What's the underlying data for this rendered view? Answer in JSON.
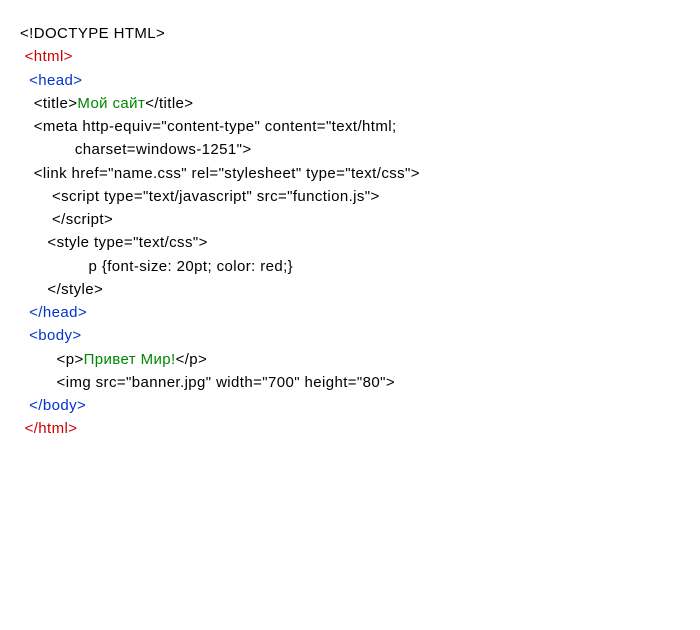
{
  "lines": [
    {
      "indent": 0,
      "segments": [
        {
          "cls": "black",
          "text": "<!DOCTYPE HTML>"
        }
      ]
    },
    {
      "indent": 1,
      "segments": [
        {
          "cls": "red",
          "text": "<html>"
        }
      ]
    },
    {
      "indent": 0,
      "segments": [
        {
          "cls": "black",
          "text": ""
        }
      ]
    },
    {
      "indent": 2,
      "segments": [
        {
          "cls": "blue",
          "text": "<head>"
        }
      ]
    },
    {
      "indent": 3,
      "segments": [
        {
          "cls": "black",
          "text": "<title>"
        },
        {
          "cls": "green",
          "text": "Мой сайт"
        },
        {
          "cls": "black",
          "text": "</title>"
        }
      ]
    },
    {
      "indent": 3,
      "segments": [
        {
          "cls": "black",
          "text": "<meta http-equiv=\"content-type\" content=\"text/html;"
        }
      ]
    },
    {
      "indent": 12,
      "segments": [
        {
          "cls": "black",
          "text": "charset=windows-1251\">"
        }
      ]
    },
    {
      "indent": 0,
      "segments": [
        {
          "cls": "black",
          "text": ""
        }
      ]
    },
    {
      "indent": 3,
      "segments": [
        {
          "cls": "black",
          "text": "<link href=\"name.css\" rel=\"stylesheet\" type=\"text/css\">"
        }
      ]
    },
    {
      "indent": 0,
      "segments": [
        {
          "cls": "black",
          "text": ""
        }
      ]
    },
    {
      "indent": 7,
      "segments": [
        {
          "cls": "black",
          "text": "<script type=\"text/javascript\" src=\"function.js\">"
        }
      ]
    },
    {
      "indent": 7,
      "segments": [
        {
          "cls": "black",
          "text": "</script>"
        }
      ]
    },
    {
      "indent": 0,
      "segments": [
        {
          "cls": "black",
          "text": ""
        }
      ]
    },
    {
      "indent": 6,
      "segments": [
        {
          "cls": "black",
          "text": "<style type=\"text/css\">"
        }
      ]
    },
    {
      "indent": 15,
      "segments": [
        {
          "cls": "black",
          "text": "p {font-size: 20pt; color: red;}"
        }
      ]
    },
    {
      "indent": 6,
      "segments": [
        {
          "cls": "black",
          "text": "</style>"
        }
      ]
    },
    {
      "indent": 2,
      "segments": [
        {
          "cls": "blue",
          "text": "</head>"
        }
      ]
    },
    {
      "indent": 0,
      "segments": [
        {
          "cls": "black",
          "text": ""
        }
      ]
    },
    {
      "indent": 2,
      "segments": [
        {
          "cls": "blue",
          "text": "<body>"
        }
      ]
    },
    {
      "indent": 8,
      "segments": [
        {
          "cls": "black",
          "text": "<p>"
        },
        {
          "cls": "green",
          "text": "Привет Мир!"
        },
        {
          "cls": "black",
          "text": "</p>"
        }
      ]
    },
    {
      "indent": 8,
      "segments": [
        {
          "cls": "black",
          "text": "<img src=\"banner.jpg\" width=\"700\" height=\"80\">"
        }
      ]
    },
    {
      "indent": 2,
      "segments": [
        {
          "cls": "blue",
          "text": "</body>"
        }
      ]
    },
    {
      "indent": 0,
      "segments": [
        {
          "cls": "black",
          "text": ""
        }
      ]
    },
    {
      "indent": 1,
      "segments": [
        {
          "cls": "red",
          "text": "</html>"
        }
      ]
    }
  ]
}
